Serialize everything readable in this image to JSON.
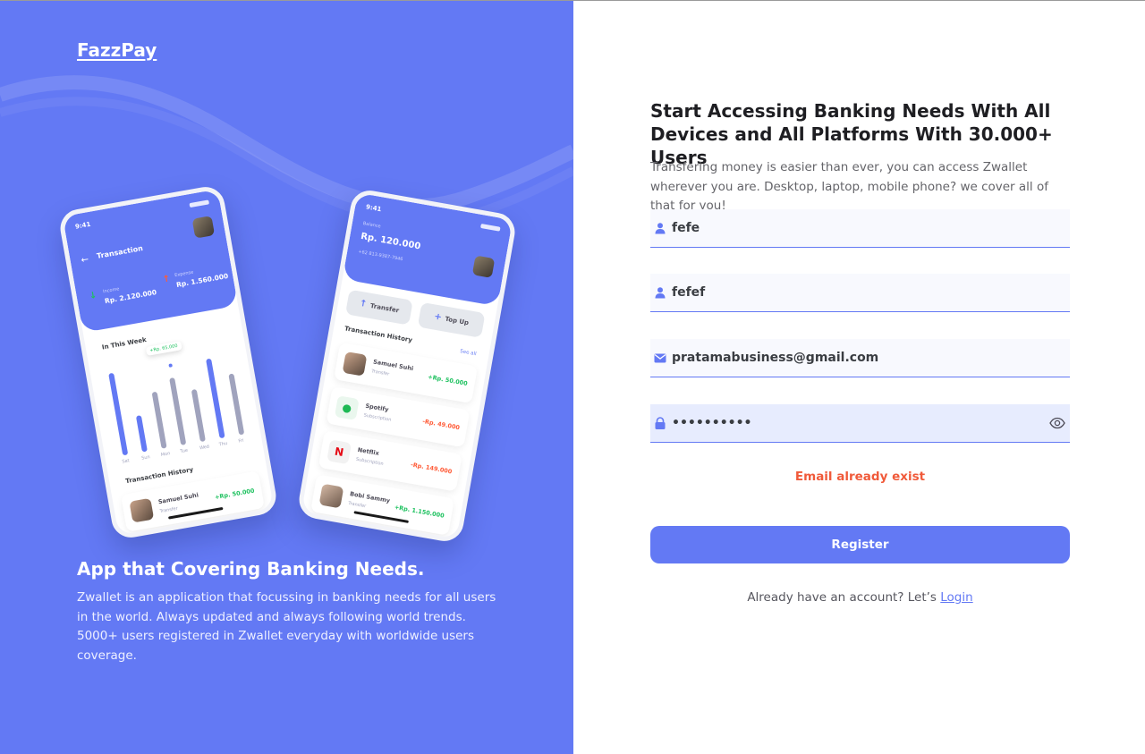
{
  "brand": {
    "name": "FazzPay"
  },
  "promo": {
    "heading": "App that Covering Banking Needs.",
    "description": "Zwallet is an application that focussing in banking needs for all users in the world. Always updated and always following world trends. 5000+ users registered in Zwallet everyday with worldwide users coverage."
  },
  "phone_left": {
    "time": "9:41",
    "title": "Transaction",
    "income_label": "Income",
    "income_amount": "Rp. 2.120.000",
    "expense_label": "Expense",
    "expense_amount": "Rp. 1.560.000",
    "week_label": "In This Week",
    "tooltip": "+Rp. 65.000",
    "days": [
      "Sat",
      "Sun",
      "Mon",
      "Tue",
      "Wed",
      "Thu",
      "Fri"
    ],
    "bar_levels": [
      0.95,
      0.42,
      0.65,
      0.78,
      0.6,
      0.92,
      0.7
    ],
    "history_label": "Transaction History",
    "row_name": "Samuel Suhi",
    "row_sub": "Transfer",
    "row_amount": "+Rp. 50.000"
  },
  "phone_right": {
    "time": "9:41",
    "balance_label": "Balance",
    "balance": "Rp. 120.000",
    "phone_number": "+62 813-9387-7946",
    "transfer_label": "Transfer",
    "topup_label": "Top Up",
    "history_label": "Transaction History",
    "see_all": "See all",
    "transactions": [
      {
        "name": "Samuel Suhi",
        "sub": "Transfer",
        "amount": "+Rp. 50.000"
      },
      {
        "name": "Spotify",
        "sub": "Subscription",
        "amount": "-Rp. 49.000"
      },
      {
        "name": "Netflix",
        "sub": "Subscription",
        "amount": "-Rp. 149.000"
      },
      {
        "name": "Bobi Sammy",
        "sub": "Transfer",
        "amount": "+Rp. 1.150.000"
      }
    ]
  },
  "form": {
    "heading": "Start Accessing Banking Needs With All Devices and All Platforms With 30.000+ Users",
    "description": "Transfering money is easier than ever, you can access Zwallet wherever you are. Desktop, laptop, mobile phone? we cover all of that for you!",
    "first_name_value": "fefe",
    "last_name_value": "fefef",
    "email_value": "pratamabusiness@gmail.com",
    "password_value": "••••••••••",
    "error_message": "Email already exist",
    "register_label": "Register",
    "login_prompt": "Already have an account? Let’s",
    "login_label": "Login"
  },
  "colors": {
    "primary": "#6379f4",
    "error": "#f05a3a",
    "income": "#1ec15f",
    "expense": "#ff5b37"
  }
}
